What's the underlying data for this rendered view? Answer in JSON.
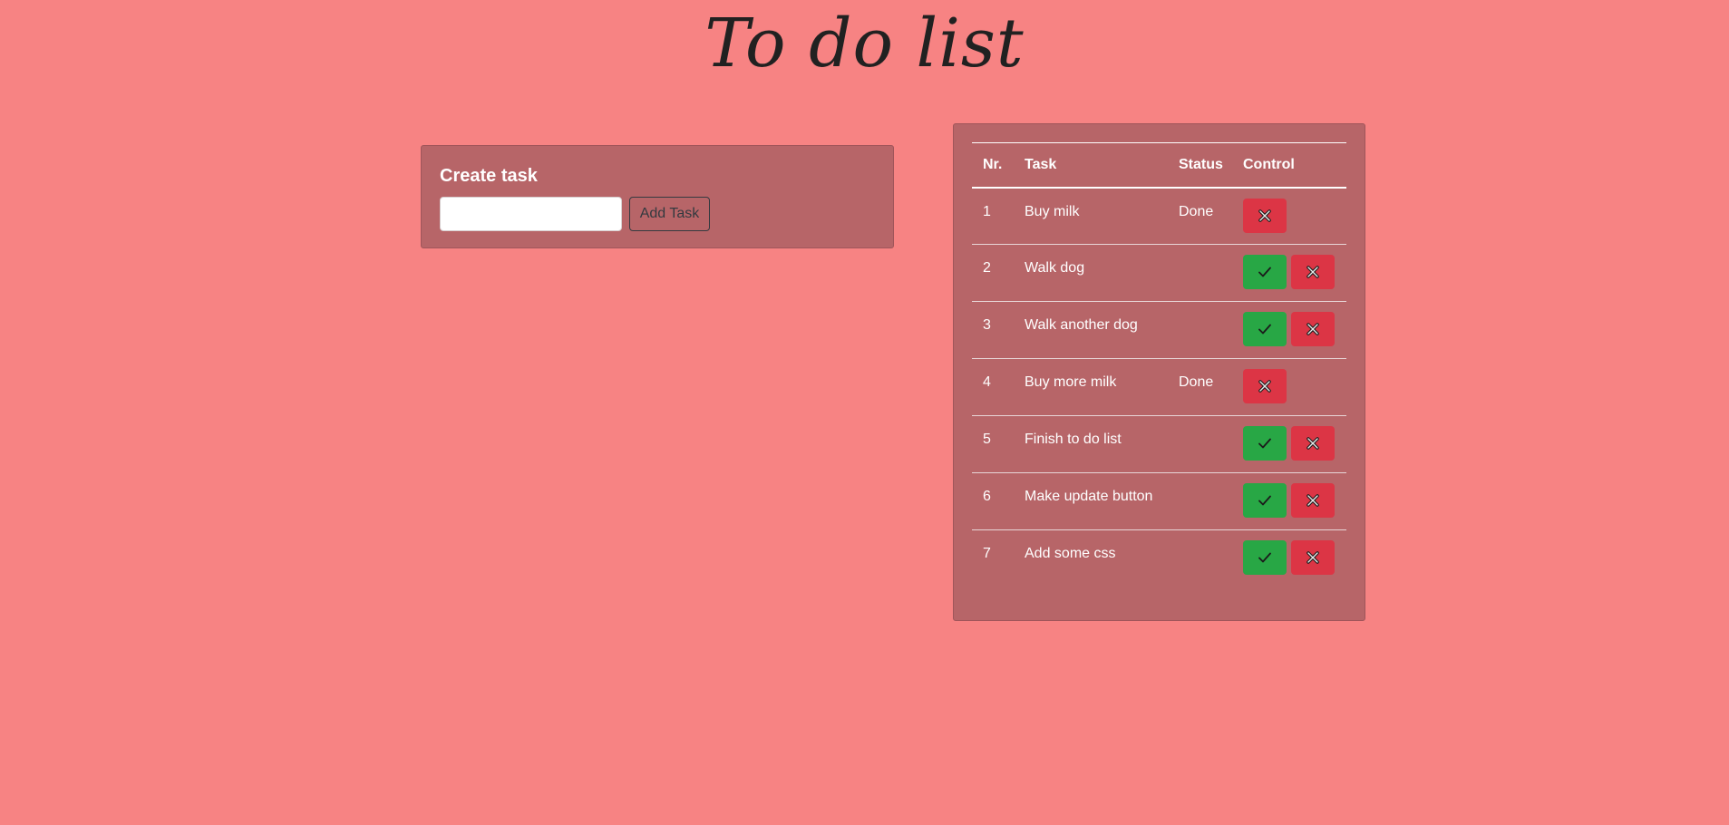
{
  "header": {
    "title": "To do list"
  },
  "create": {
    "heading": "Create task",
    "input_value": "",
    "input_placeholder": "",
    "add_label": "Add Task"
  },
  "table": {
    "columns": [
      "Nr.",
      "Task",
      "Status",
      "Control"
    ],
    "rows": [
      {
        "nr": "1",
        "task": "Buy milk",
        "status": "Done",
        "done": true
      },
      {
        "nr": "2",
        "task": "Walk dog",
        "status": "",
        "done": false
      },
      {
        "nr": "3",
        "task": "Walk another dog",
        "status": "",
        "done": false
      },
      {
        "nr": "4",
        "task": "Buy more milk",
        "status": "Done",
        "done": true
      },
      {
        "nr": "5",
        "task": "Finish to do list",
        "status": "",
        "done": false
      },
      {
        "nr": "6",
        "task": "Make update button",
        "status": "",
        "done": false
      },
      {
        "nr": "7",
        "task": "Add some css",
        "status": "",
        "done": false
      }
    ]
  },
  "icons": {
    "done": "check-icon",
    "delete": "x-icon"
  },
  "colors": {
    "background": "#f78383",
    "panel": "#b76568",
    "done_button": "#28a745",
    "delete_button": "#dc3545",
    "title": "#212121"
  }
}
